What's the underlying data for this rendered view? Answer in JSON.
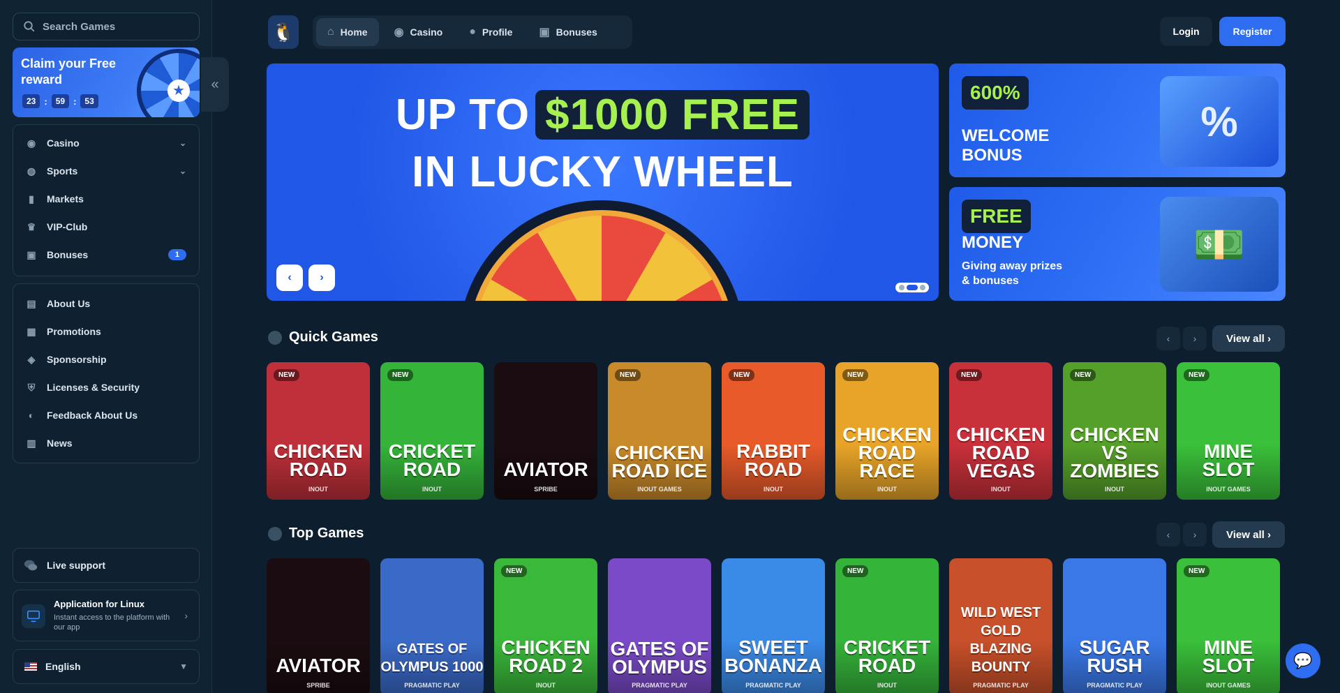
{
  "search": {
    "placeholder": "Search Games"
  },
  "reward": {
    "title": "Claim your Free reward",
    "hours": "23",
    "minutes": "59",
    "seconds": "53"
  },
  "sidebar": {
    "main_items": [
      {
        "label": "Casino",
        "icon": "casino-chip-icon",
        "expandable": true
      },
      {
        "label": "Sports",
        "icon": "globe-ball-icon",
        "expandable": true
      },
      {
        "label": "Markets",
        "icon": "candlestick-icon"
      },
      {
        "label": "VIP-Club",
        "icon": "crown-icon"
      },
      {
        "label": "Bonuses",
        "icon": "gift-icon",
        "badge": "1"
      }
    ],
    "info_items": [
      {
        "label": "About Us",
        "icon": "book-icon"
      },
      {
        "label": "Promotions",
        "icon": "ticket-icon"
      },
      {
        "label": "Sponsorship",
        "icon": "medal-icon"
      },
      {
        "label": "Licenses & Security",
        "icon": "shield-icon"
      },
      {
        "label": "Feedback About Us",
        "icon": "feedback-icon"
      },
      {
        "label": "News",
        "icon": "newspaper-icon"
      }
    ],
    "live_support": "Live support",
    "app": {
      "title": "Application for Linux",
      "subtitle": "Instant access to the platform with our app"
    },
    "language": "English"
  },
  "header": {
    "tabs": [
      {
        "label": "Home",
        "icon": "home-icon",
        "active": true
      },
      {
        "label": "Casino",
        "icon": "casino-chip-icon"
      },
      {
        "label": "Profile",
        "icon": "user-icon"
      },
      {
        "label": "Bonuses",
        "icon": "gift-icon"
      }
    ],
    "login": "Login",
    "register": "Register"
  },
  "hero": {
    "line1_prefix": "UP TO",
    "line1_highlight": "$1000 FREE",
    "line2": "IN LUCKY WHEEL",
    "slide_count": 3,
    "active_slide": 2
  },
  "promos": [
    {
      "pill": "600%",
      "title": "WELCOME BONUS",
      "subtitle": ""
    },
    {
      "pill": "FREE",
      "title": "MONEY",
      "subtitle": "Giving away prizes & bonuses"
    }
  ],
  "colors": {
    "accent": "#2f6df0",
    "highlight": "#a6f050"
  },
  "quick_games": {
    "title": "Quick Games",
    "view_all": "View all",
    "games": [
      {
        "name": "CHICKEN ROAD",
        "provider": "INOUT",
        "new": true,
        "bg": "#c0303a"
      },
      {
        "name": "CRICKET ROAD",
        "provider": "INOUT",
        "new": true,
        "bg": "#35b43a"
      },
      {
        "name": "AVIATOR",
        "provider": "SPRIBE",
        "new": false,
        "bg": "#1a0c10"
      },
      {
        "name": "CHICKEN ROAD ICE",
        "provider": "INOUT GAMES",
        "new": true,
        "bg": "#c98a2a"
      },
      {
        "name": "RABBIT ROAD",
        "provider": "INOUT",
        "new": true,
        "bg": "#e85a2a"
      },
      {
        "name": "CHICKEN ROAD RACE",
        "provider": "INOUT",
        "new": true,
        "bg": "#e8a428"
      },
      {
        "name": "CHICKEN ROAD VEGAS",
        "provider": "INOUT",
        "new": true,
        "bg": "#c8303a"
      },
      {
        "name": "CHICKEN VS ZOMBIES",
        "provider": "INOUT",
        "new": true,
        "bg": "#55a02a"
      },
      {
        "name": "MINE SLOT",
        "provider": "INOUT GAMES",
        "new": true,
        "bg": "#3ac03a"
      }
    ]
  },
  "top_games": {
    "title": "Top Games",
    "view_all": "View all",
    "games": [
      {
        "name": "AVIATOR",
        "provider": "SPRIBE",
        "new": false,
        "bg": "#1a0c10"
      },
      {
        "name": "GATES OF OLYMPUS 1000",
        "provider": "PRAGMATIC PLAY",
        "new": false,
        "bg": "#3a6ac8"
      },
      {
        "name": "CHICKEN ROAD 2",
        "provider": "INOUT",
        "new": true,
        "bg": "#3ab83a"
      },
      {
        "name": "GATES OF OLYMPUS",
        "provider": "PRAGMATIC PLAY",
        "new": false,
        "bg": "#7a4ac8"
      },
      {
        "name": "SWEET BONANZA",
        "provider": "PRAGMATIC PLAY",
        "new": false,
        "bg": "#3a8ae8"
      },
      {
        "name": "CRICKET ROAD",
        "provider": "INOUT",
        "new": true,
        "bg": "#35b43a"
      },
      {
        "name": "WILD WEST GOLD BLAZING BOUNTY",
        "provider": "PRAGMATIC PLAY",
        "new": false,
        "bg": "#c8502a"
      },
      {
        "name": "SUGAR RUSH",
        "provider": "PRAGMATIC PLAY",
        "new": false,
        "bg": "#3a78e8"
      },
      {
        "name": "MINE SLOT",
        "provider": "INOUT GAMES",
        "new": true,
        "bg": "#3ac03a"
      }
    ]
  }
}
